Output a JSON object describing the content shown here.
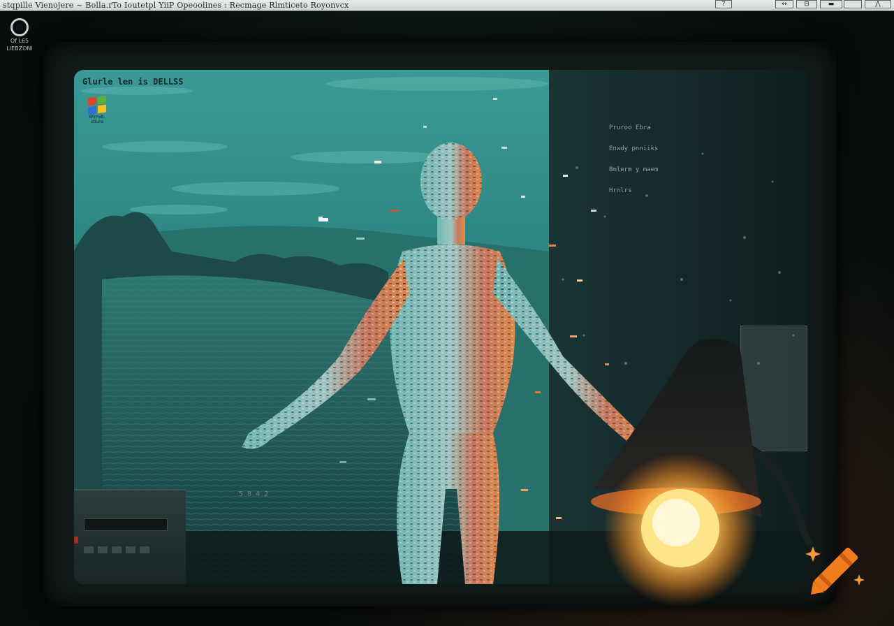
{
  "titlebar": {
    "text": "stqpille  Vienojere  ~ Bolla.rTo Ioutetpl  YiiP  Opeoolines :  Recmage Rlmticeto Royonvcx",
    "buttons": [
      "?",
      "↔",
      "⊟",
      "▬",
      "",
      "⋀"
    ]
  },
  "corner_badge": {
    "line1": "Of L65",
    "line2": "LIEBZONI"
  },
  "desktop": {
    "title": "Glurle len is DELLSS",
    "logo_caption": "Wirmdl-ctiuns",
    "right_text": [
      "Pruroo Ebra",
      "Enwdy pnniiks",
      "Bmlerm y maem",
      "Hrnlrs"
    ],
    "lower_text": "5 8  4 2"
  },
  "colors": {
    "screen_teal": "#2b8a86",
    "lamp_glow": "#ffb347",
    "crayon": "#f07c1e"
  },
  "icons": [
    "gear-icon",
    "windows-logo-icon",
    "crayon-icon",
    "sparkle-icon"
  ]
}
